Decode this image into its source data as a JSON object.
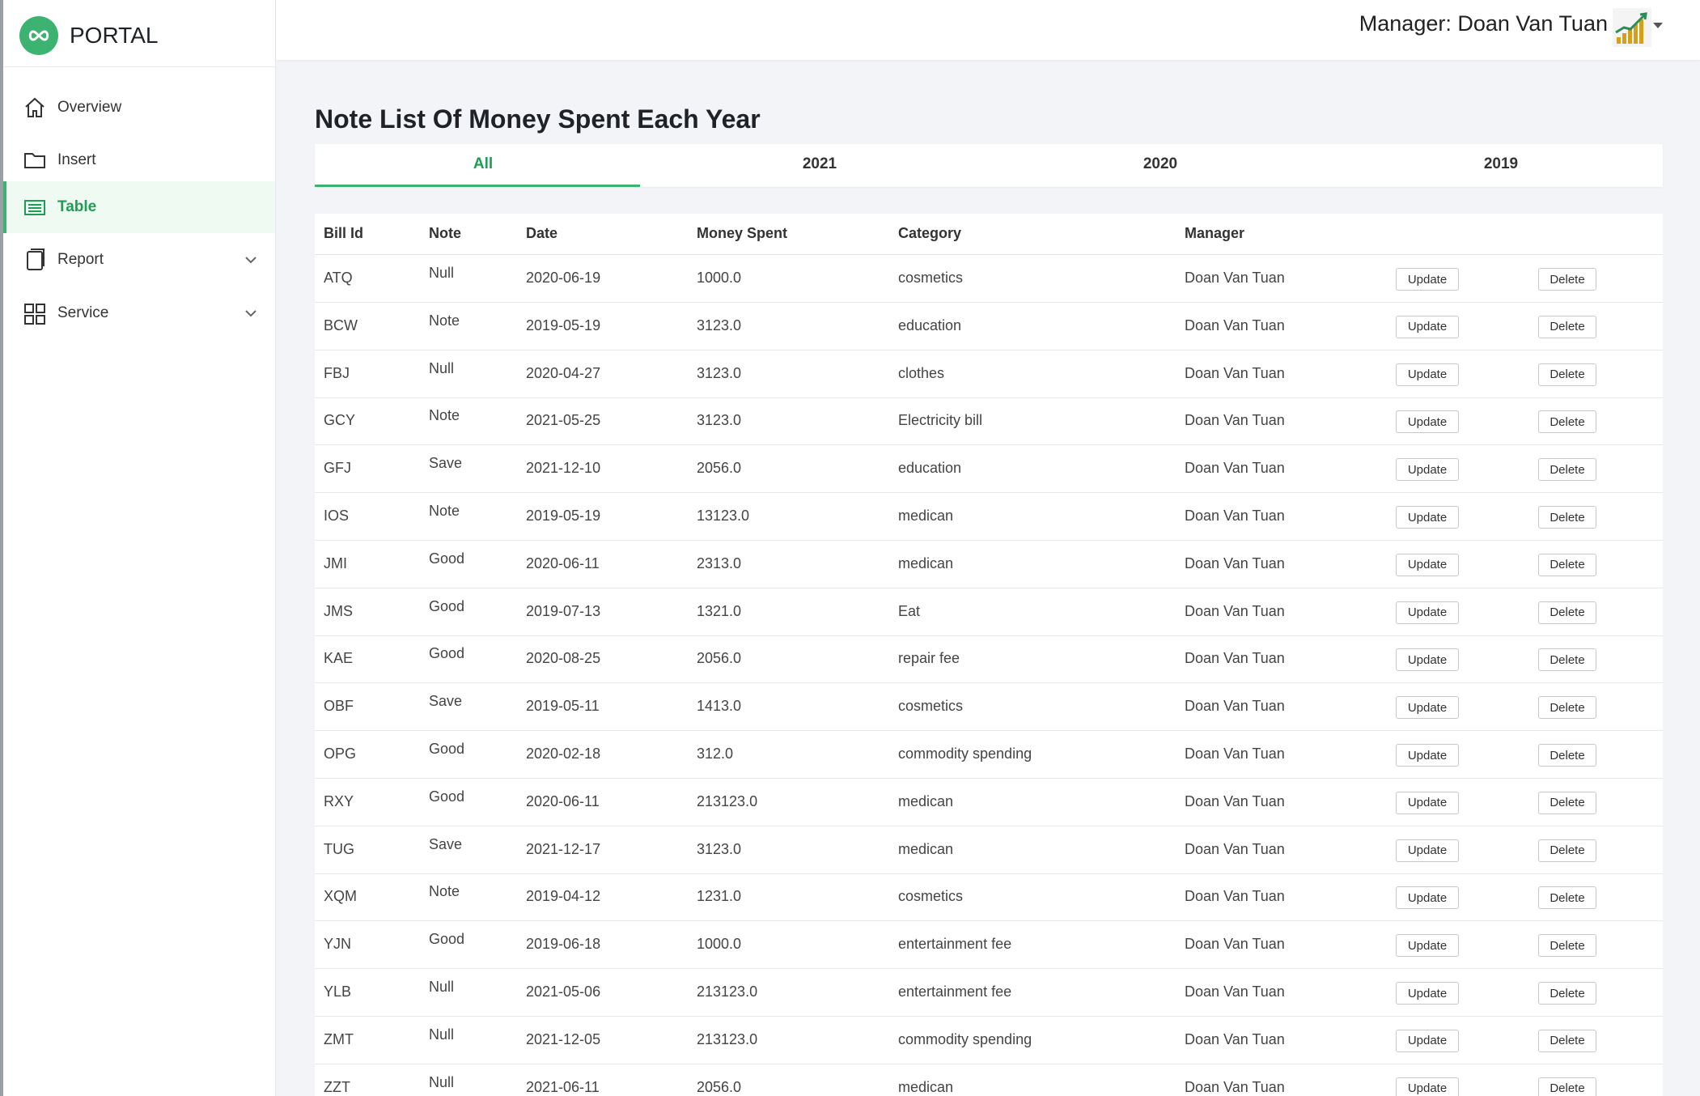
{
  "app": {
    "name": "PORTAL"
  },
  "nav": [
    {
      "label": "Overview",
      "icon": "home-icon"
    },
    {
      "label": "Insert",
      "icon": "folder-icon"
    },
    {
      "label": "Table",
      "icon": "table-icon",
      "active": true
    },
    {
      "label": "Report",
      "icon": "report-icon",
      "expandable": true
    },
    {
      "label": "Service",
      "icon": "grid-icon",
      "expandable": true
    }
  ],
  "header": {
    "manager": "Manager: Doan Van Tuan"
  },
  "page": {
    "title": "Note List Of Money Spent Each Year"
  },
  "tabs": [
    "All",
    "2021",
    "2020",
    "2019"
  ],
  "table": {
    "columns": [
      "Bill Id",
      "Note",
      "Date",
      "Money Spent",
      "Category",
      "Manager"
    ],
    "update_label": "Update",
    "delete_label": "Delete",
    "rows": [
      [
        "ATQ",
        "Null",
        "2020-06-19",
        "1000.0",
        "cosmetics",
        "Doan Van Tuan"
      ],
      [
        "BCW",
        "Note",
        "2019-05-19",
        "3123.0",
        "education",
        "Doan Van Tuan"
      ],
      [
        "FBJ",
        "Null",
        "2020-04-27",
        "3123.0",
        "clothes",
        "Doan Van Tuan"
      ],
      [
        "GCY",
        "Note",
        "2021-05-25",
        "3123.0",
        "Electricity bill",
        "Doan Van Tuan"
      ],
      [
        "GFJ",
        "Save",
        "2021-12-10",
        "2056.0",
        "education",
        "Doan Van Tuan"
      ],
      [
        "IOS",
        "Note",
        "2019-05-19",
        "13123.0",
        "medican",
        "Doan Van Tuan"
      ],
      [
        "JMI",
        "Good",
        "2020-06-11",
        "2313.0",
        "medican",
        "Doan Van Tuan"
      ],
      [
        "JMS",
        "Good",
        "2019-07-13",
        "1321.0",
        "Eat",
        "Doan Van Tuan"
      ],
      [
        "KAE",
        "Good",
        "2020-08-25",
        "2056.0",
        "repair fee",
        "Doan Van Tuan"
      ],
      [
        "OBF",
        "Save",
        "2019-05-11",
        "1413.0",
        "cosmetics",
        "Doan Van Tuan"
      ],
      [
        "OPG",
        "Good",
        "2020-02-18",
        "312.0",
        "commodity spending",
        "Doan Van Tuan"
      ],
      [
        "RXY",
        "Good",
        "2020-06-11",
        "213123.0",
        "medican",
        "Doan Van Tuan"
      ],
      [
        "TUG",
        "Save",
        "2021-12-17",
        "3123.0",
        "medican",
        "Doan Van Tuan"
      ],
      [
        "XQM",
        "Note",
        "2019-04-12",
        "1231.0",
        "cosmetics",
        "Doan Van Tuan"
      ],
      [
        "YJN",
        "Good",
        "2019-06-18",
        "1000.0",
        "entertainment fee",
        "Doan Van Tuan"
      ],
      [
        "YLB",
        "Null",
        "2021-05-06",
        "213123.0",
        "entertainment fee",
        "Doan Van Tuan"
      ],
      [
        "ZMT",
        "Null",
        "2021-12-05",
        "213123.0",
        "commodity spending",
        "Doan Van Tuan"
      ],
      [
        "ZZT",
        "Null",
        "2021-06-11",
        "2056.0",
        "medican",
        "Doan Van Tuan"
      ]
    ]
  },
  "colors": {
    "accent": "#3cb371",
    "accent_text": "#1f9d55",
    "active_bg": "#eefaf2"
  }
}
